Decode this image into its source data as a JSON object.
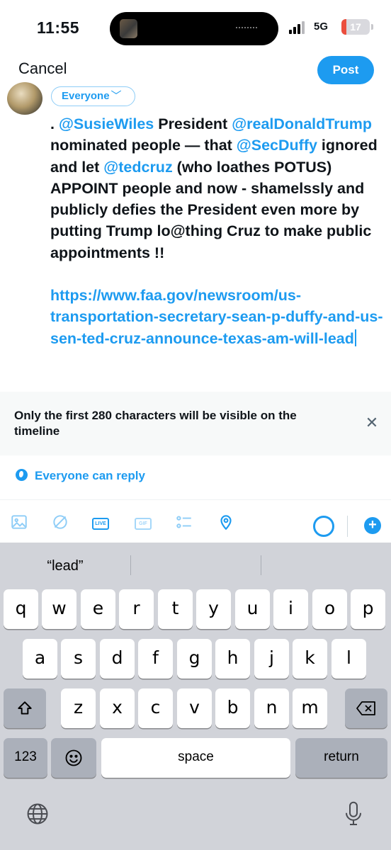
{
  "status_bar": {
    "time": "11:55",
    "network": "5G",
    "battery_level": "17"
  },
  "header": {
    "cancel_label": "Cancel",
    "post_label": "Post"
  },
  "composer": {
    "audience_label": "Everyone",
    "text_intro": ". ",
    "mention_1": "@SusieWiles",
    "text_1": " President ",
    "mention_2": "@realDonaldTrump",
    "text_2": " nominated people — that ",
    "mention_3": "@SecDuffy",
    "text_3": " ignored and  let ",
    "mention_4": "@tedcruz",
    "text_4": " (who loathes POTUS) APPOINT people and now - shamelssly and publicly defies the President even more by putting Trump lo@thing Cruz to make public appointments !!",
    "link": "https://www.faa.gov/newsroom/us-transportation-secretary-sean-p-duffy-and-us-sen-ted-cruz-announce-texas-am-will-lead"
  },
  "notice": {
    "text": "Only the first 280 characters will be visible on the timeline"
  },
  "reply_setting": {
    "label": "Everyone can reply"
  },
  "toolbar": {
    "live_label": "LIVE",
    "gif_label": "GIF",
    "add_label": "+"
  },
  "keyboard": {
    "suggestion": "“lead”",
    "row1": [
      "q",
      "w",
      "e",
      "r",
      "t",
      "y",
      "u",
      "i",
      "o",
      "p"
    ],
    "row2": [
      "a",
      "s",
      "d",
      "f",
      "g",
      "h",
      "j",
      "k",
      "l"
    ],
    "row3": [
      "z",
      "x",
      "c",
      "v",
      "b",
      "n",
      "m"
    ],
    "numbers_label": "123",
    "space_label": "space",
    "return_label": "return"
  }
}
